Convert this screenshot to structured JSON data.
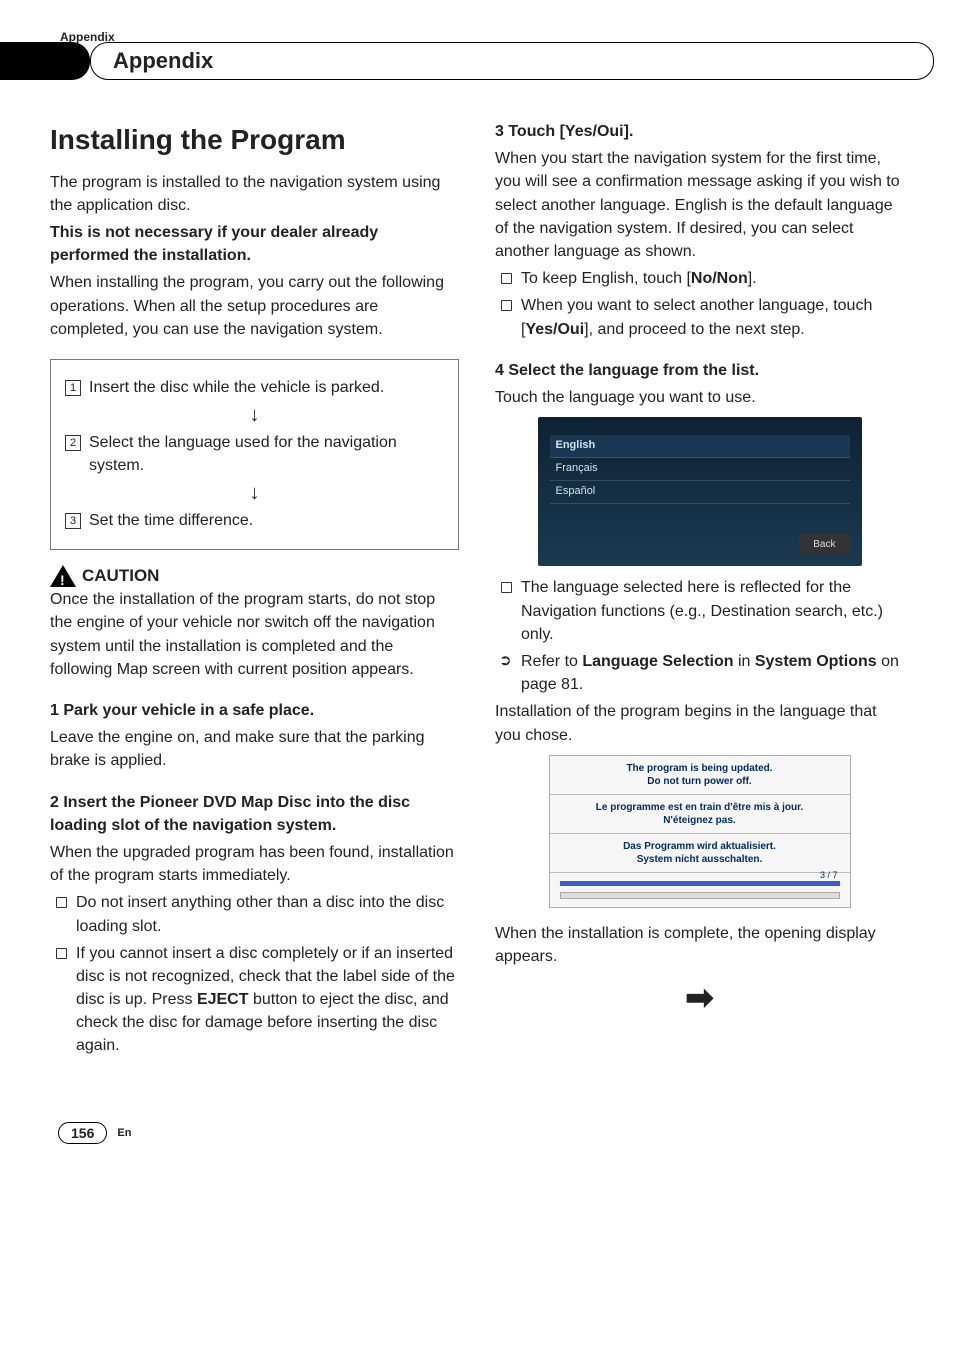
{
  "running_head": "Appendix",
  "chapter_title": "Appendix",
  "left": {
    "h1": "Installing the Program",
    "intro1": "The program is installed to the navigation system using the application disc.",
    "intro2": "This is not necessary if your dealer already performed the installation.",
    "intro3": "When installing the program, you carry out the following operations. When all the setup procedures are completed, you can use the navigation system.",
    "box": {
      "s1": "Insert the disc while the vehicle is parked.",
      "s2": "Select the language used for the navigation system.",
      "s3": "Set the time difference."
    },
    "caution_label": "CAUTION",
    "caution_body": "Once the installation of the program starts, do not stop the engine of your vehicle nor switch off the navigation system until the installation is completed and the following Map screen with current position appears.",
    "step1_head": "1    Park your vehicle in a safe place.",
    "step1_body": "Leave the engine on, and make sure that the parking brake is applied.",
    "step2_head": "2    Insert the Pioneer DVD Map Disc into the disc loading slot of the navigation system.",
    "step2_body": "When the upgraded program has been found, installation of the program starts immediately.",
    "step2_b1": "Do not insert anything other than a disc into the disc loading slot.",
    "step2_b2a": "If you cannot insert a disc completely or if an inserted disc is not recognized, check that the label side of the disc is up. Press ",
    "step2_b2_bold": "EJECT",
    "step2_b2b": " button to eject the disc, and check the disc for damage before inserting the disc again."
  },
  "right": {
    "step3_head": "3    Touch [Yes/Oui].",
    "step3_body": "When you start the navigation system for the first time, you will see a confirmation message asking if you wish to select another language. English is the default language of the navigation system. If desired, you can select another language as shown.",
    "step3_b1a": "To keep English, touch [",
    "step3_b1_bold": "No/Non",
    "step3_b1b": "].",
    "step3_b2a": "When you want to select another language, touch [",
    "step3_b2_bold": "Yes/Oui",
    "step3_b2b": "], and proceed to the next step.",
    "step4_head": "4    Select the language from the list.",
    "step4_body": "Touch the language you want to use.",
    "lang_items": [
      "English",
      "Français",
      "Español"
    ],
    "back_label": "Back",
    "step4_b1": "The language selected here is reflected for the Navigation functions (e.g., Destination search, etc.) only.",
    "step4_ref_a": "Refer to ",
    "step4_ref_bold1": "Language Selection",
    "step4_ref_mid": " in ",
    "step4_ref_bold2": "System Options",
    "step4_ref_b": " on page 81.",
    "install_begin": "Installation of the program begins in the language that you chose.",
    "ss2_line1a": "The program is being updated.",
    "ss2_line1b": "Do not turn power off.",
    "ss2_line2a": "Le programme est en train d'être mis à jour.",
    "ss2_line2b": "N'éteignez pas.",
    "ss2_line3a": "Das Programm wird aktualisiert.",
    "ss2_line3b": "System nicht ausschalten.",
    "ss2_pct": "3 / 7",
    "install_done": "When the installation is complete, the opening display appears."
  },
  "footer": {
    "page": "156",
    "lang": "En"
  }
}
